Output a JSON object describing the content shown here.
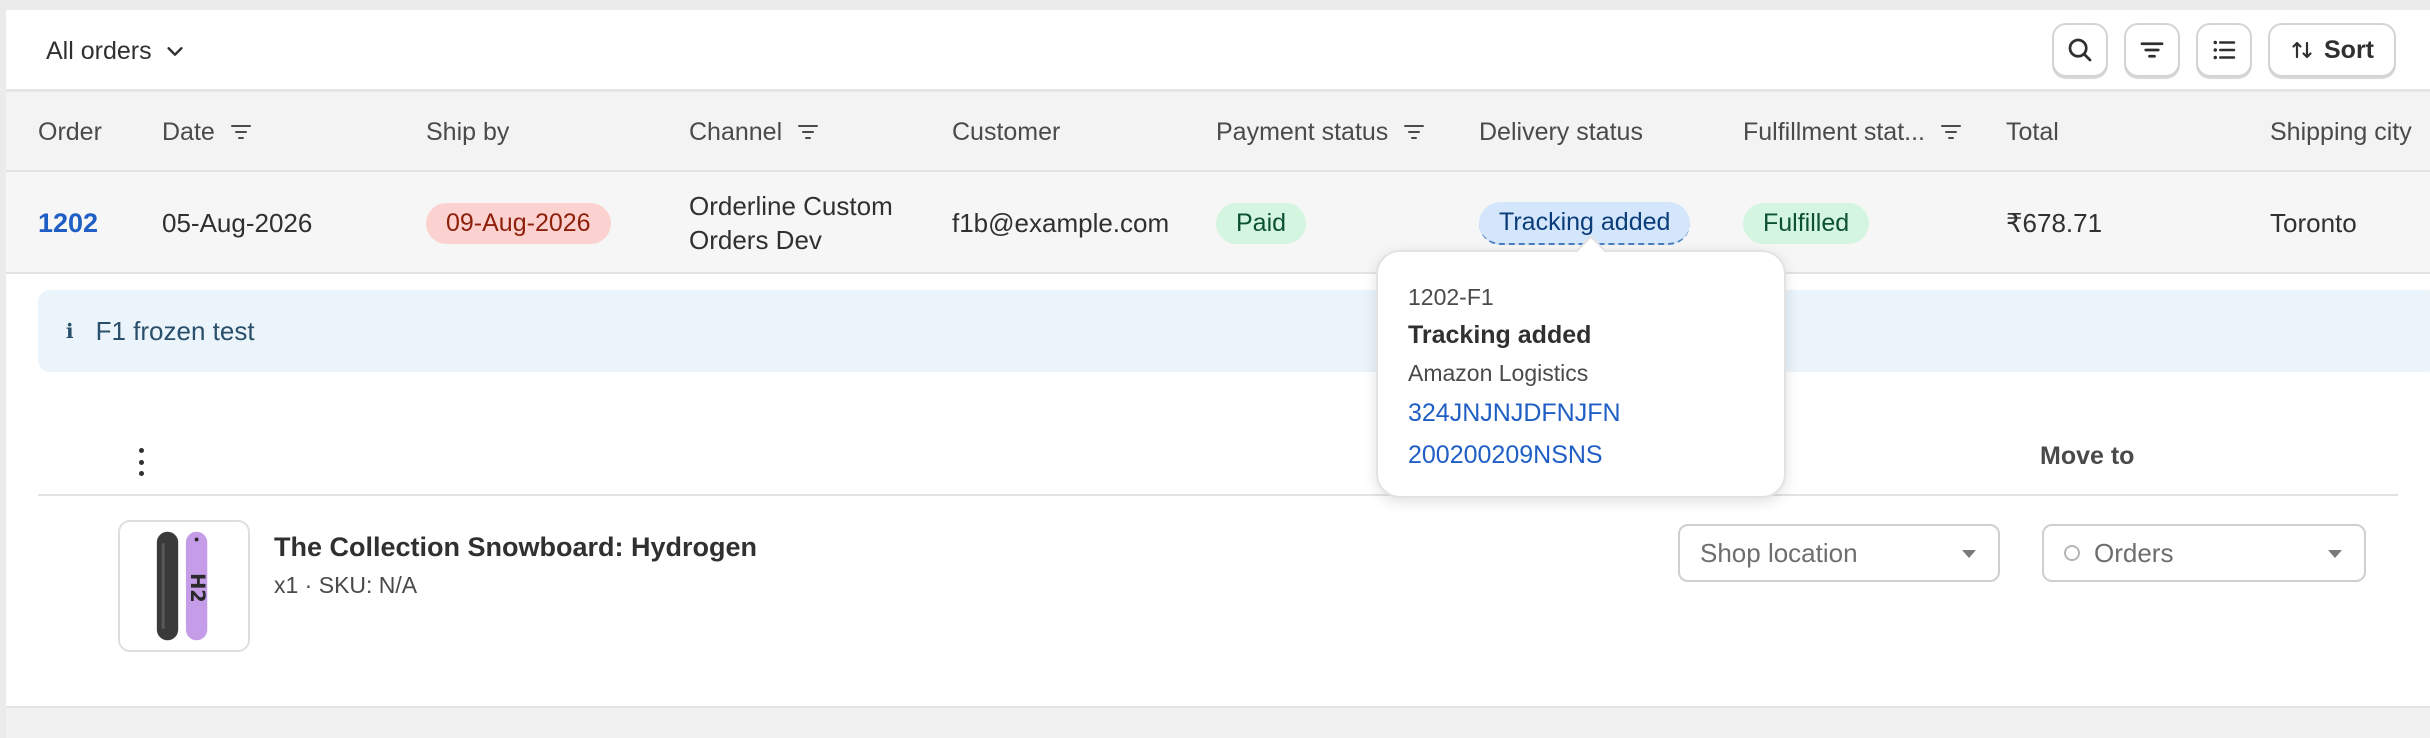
{
  "toolbar": {
    "view_label": "All orders",
    "icons": [
      "search-icon",
      "filter-icon",
      "list-icon",
      "sort-icon"
    ],
    "sort_label": "Sort"
  },
  "table": {
    "columns": [
      {
        "label": "Order",
        "filter": false
      },
      {
        "label": "Date",
        "filter": true
      },
      {
        "label": "Ship by",
        "filter": false
      },
      {
        "label": "Channel",
        "filter": true
      },
      {
        "label": "Customer",
        "filter": false
      },
      {
        "label": "Payment status",
        "filter": true
      },
      {
        "label": "Delivery status",
        "filter": false
      },
      {
        "label": "Fulfillment stat...",
        "filter": true
      },
      {
        "label": "Total",
        "filter": false
      },
      {
        "label": "Shipping city",
        "filter": false
      }
    ],
    "row": {
      "order": "1202",
      "date": "05-Aug-2026",
      "ship_by": "09-Aug-2026",
      "channel": "Orderline Custom Orders Dev",
      "customer": "f1b@example.com",
      "payment_status": "Paid",
      "delivery_status": "Tracking added",
      "fulfillment_status": "Fulfilled",
      "total": "₹678.71",
      "shipping_city": "Toronto"
    }
  },
  "note": {
    "icon": "info-icon",
    "text": "F1 frozen test"
  },
  "fulfillment": {
    "move_to_label": "Move to",
    "product": {
      "name": "The Collection Snowboard: Hydrogen",
      "meta": "x1 · SKU: N/A"
    },
    "location_select": {
      "value": "Shop location"
    },
    "move_select": {
      "value": "Orders"
    }
  },
  "popover": {
    "fulfillment_id": "1202-F1",
    "title": "Tracking added",
    "carrier": "Amazon Logistics",
    "tracking_numbers": [
      "324JNJNJDFNJFN",
      "200200209NSNS"
    ]
  },
  "colors": {
    "link": "#1f5fc5",
    "paid_bg": "#d4f5df",
    "ship_by_bg": "#fcd2d0",
    "tracking_bg": "#d4e6fb"
  }
}
